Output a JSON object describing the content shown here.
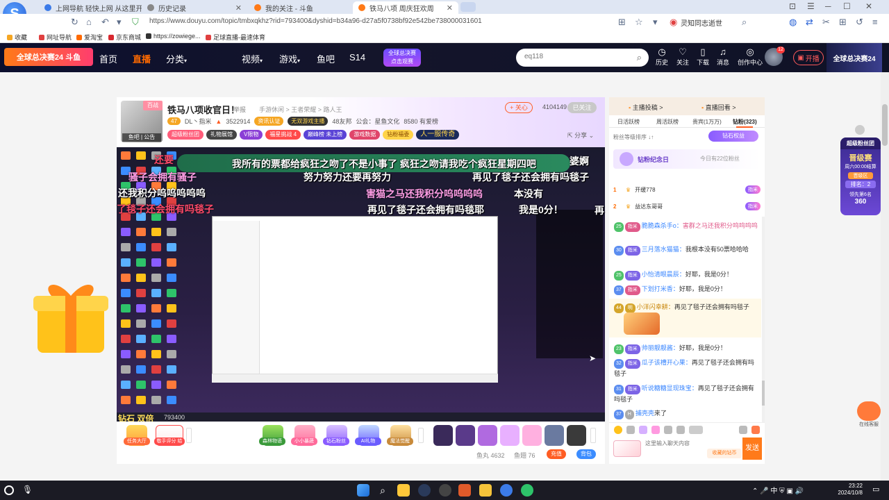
{
  "browser": {
    "tabs": [
      {
        "label": "上网导航  轻快上网 从这里开始"
      },
      {
        "label": "历史记录"
      },
      {
        "label": "我的关注 - 斗鱼"
      },
      {
        "label": "铁马八项 周庆狂欢周"
      }
    ],
    "url": "https://www.douyu.com/topic/tmbxqkhz?rid=793400&dyshid=b34a96-d27a5f0738bf92e542be738000031601",
    "hotword": "灵知同志逝世",
    "bookmarks": [
      "收藏",
      "网址导航",
      "爱淘宝",
      "京东商城",
      "https://zowiege...",
      "足球直播-最速体育"
    ]
  },
  "header": {
    "logo_text": "全球总决赛24 斗鱼",
    "nav": [
      "首页",
      "直播",
      "分类",
      "视频",
      "游戏",
      "鱼吧",
      "S14"
    ],
    "promo_line1": "全球总决赛",
    "promo_line2": "点击观赛",
    "search_placeholder": "eq118",
    "icons": [
      "历史",
      "关注",
      "下载",
      "消息",
      "创作中心"
    ],
    "avatar_badge": "12",
    "open_live": "开播",
    "right_banner": "全球总决赛24"
  },
  "room": {
    "anchor_tag": "百战",
    "anchor_sub": "鱼吧 | 公告",
    "title": "铁马八项收官日！",
    "report": "举报",
    "crumbs": "手游休闲 > 王者荣耀 > 路人王",
    "follow": "+ 关心",
    "fans": "4104149",
    "followed": "已关注",
    "anchor_name": "DL丶指米",
    "hot": "3522914",
    "verified": "资讯认证",
    "vip": "无双游戏主播",
    "people": "48友邦",
    "notice": "公会：星鱼文化",
    "likes": "8580 有爱榜",
    "tags": [
      "超级粉丝团",
      "礼物展馆",
      "V限物",
      "福星挑战 4",
      "巅峰榜 未上榜",
      "游戏数据",
      "钻粉福委",
      "人一服传奇"
    ],
    "share": "分享"
  },
  "video": {
    "barrage": [
      {
        "text": "我所有的票都给疯狂之吻了不是小事了 疯狂之吻请我吃个疯狂星期四吧"
      },
      {
        "text": "还要"
      },
      {
        "text": "骚子会拥有骚子"
      },
      {
        "text": "努力努力还要再努力"
      },
      {
        "text": "再见了毯子还会拥有吗毯子"
      },
      {
        "text": "还我积分呜呜呜呜呜"
      },
      {
        "text": "害猫之马还我积分呜呜呜呜"
      },
      {
        "text": "本没有"
      },
      {
        "text": "了毯子还会拥有吗毯子"
      },
      {
        "text": "再见了毯子还会拥有吗毯耶"
      },
      {
        "text": "我是0分！"
      },
      {
        "text": "婆婀"
      },
      {
        "text": "再"
      }
    ],
    "diamond_label": "钻石 双倍",
    "room_id": "793400"
  },
  "giftbar": {
    "left_labels": [
      "任务大厅",
      "敬手评分 给TA打分"
    ],
    "right_labels": [
      "森林物语",
      "小小暴蔬",
      "钻石粉丝",
      "AI礼物",
      "魔法觉醒"
    ],
    "yuwan": "鱼丸 4632",
    "yuchi": "鱼翅 76",
    "recharge": "充值",
    "bag": "背包"
  },
  "rpanel": {
    "top_left": "主播投稿 >",
    "top_right": "直播回看 >",
    "tabs": [
      "日活跃榜",
      "周活跃榜",
      "贵宾(1万万)",
      "钻粉(323)"
    ],
    "fan_rank": "粉丝等级排序 ↓↑",
    "diamond_btn": "钻石权益",
    "anniv_title": "钻粉纪念日",
    "anniv_right": "今日有22位粉丝",
    "ranks": [
      {
        "num": "1",
        "name": "开缓778",
        "badge": "指米"
      },
      {
        "num": "2",
        "name": "益达东哥哥",
        "badge": "指米"
      }
    ],
    "messages": [
      {
        "lv": "25",
        "fb": "指米",
        "name": "脆脆森杀手o：",
        "text": "害群之马还我积分呜呜呜呜"
      },
      {
        "lv": "30",
        "fb": "指米",
        "name": "三月落水猫猫：",
        "text": "我根本没有50票哈哈哈"
      },
      {
        "lv": "25",
        "fb": "指米",
        "name": "小怡清眼晨辰：",
        "text": "好耶，我是0分！"
      },
      {
        "lv": "37",
        "fb": "指米",
        "name": "下划打米香：",
        "text": "好耶，我是0分！"
      },
      {
        "lv": "44",
        "fb": "明",
        "name": "小洋闪幸耕：",
        "text": "再见了毯子还会拥有吗毯子"
      },
      {
        "lv": "23",
        "fb": "指米",
        "name": "帅丽靓靓酱：",
        "text": "好耶，我是0分！"
      },
      {
        "lv": "32",
        "fb": "指米",
        "name": "瓜子该槽开心果：",
        "text": "再见了毯子还会拥有吗毯子"
      },
      {
        "lv": "31",
        "fb": "指米",
        "name": "听说糖糖显现珠宝：",
        "text": "再见了毯子还会拥有吗毯子"
      },
      {
        "lv": "37",
        "fb": "H",
        "name": "捕壳壳",
        "text": "来了"
      }
    ],
    "input_placeholder": "这里输入聊天内容",
    "send_hint": "收藏的钻币",
    "send": "发送"
  },
  "superfan": {
    "title": "超级粉丝团",
    "line1": "晋级赛",
    "line2": "周六00:00结算",
    "rank_label": "晋级区",
    "rank": "排名：2",
    "lead_label": "领先第6名",
    "lead": "360"
  },
  "support": {
    "label": "在线客服"
  },
  "taskbar": {
    "time": "23:22",
    "date": "2024/10/8",
    "ime": "中"
  }
}
